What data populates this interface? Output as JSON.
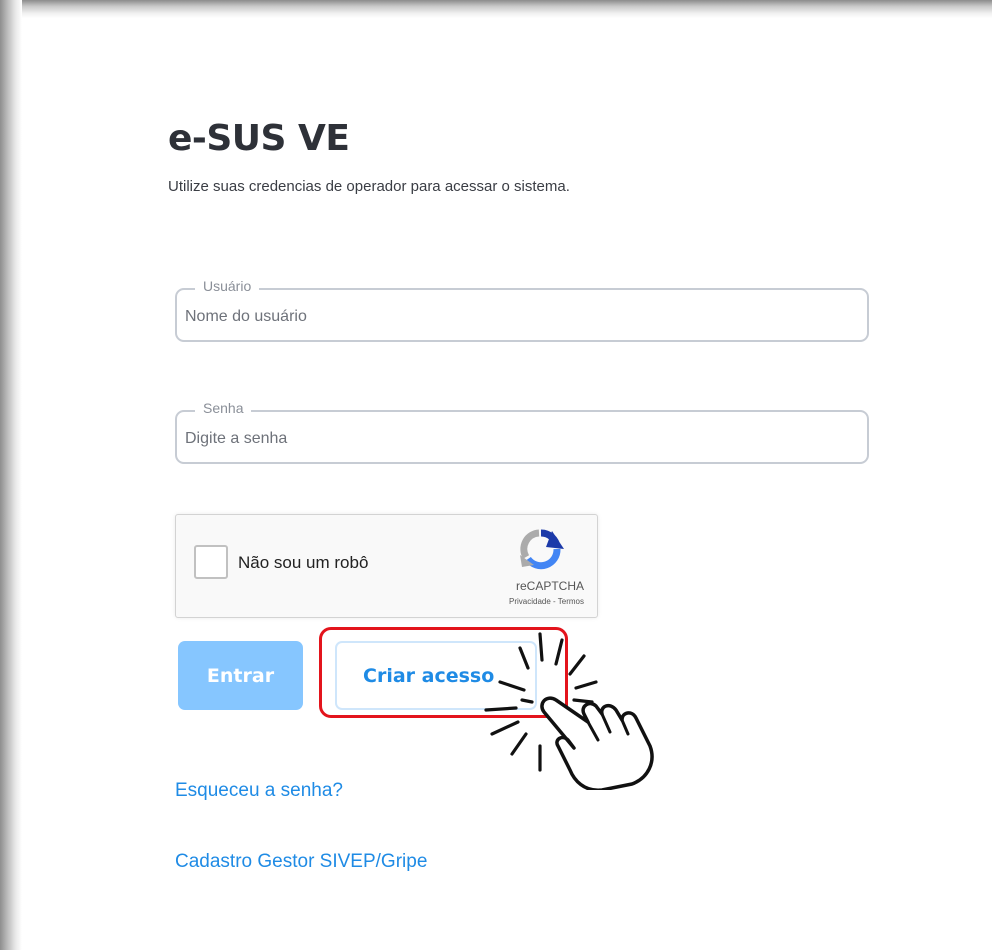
{
  "header": {
    "title": "e-SUS VE",
    "subtitle": "Utilize suas credencias de operador para acessar o sistema."
  },
  "form": {
    "username": {
      "legend": "Usuário",
      "placeholder": "Nome do usuário",
      "value": ""
    },
    "password": {
      "legend": "Senha",
      "placeholder": "Digite a senha",
      "value": ""
    },
    "captcha": {
      "label": "Não sou um robô",
      "brand": "reCAPTCHA",
      "links": "Privacidade - Termos",
      "checked": false
    },
    "buttons": {
      "login_label": "Entrar",
      "create_access_label": "Criar acesso"
    }
  },
  "links": {
    "forgot_password": "Esqueceu a senha?",
    "gestor_registration": "Cadastro Gestor SIVEP/Gripe"
  },
  "colors": {
    "primary": "#1f8be5",
    "primary_disabled": "#86c6ff",
    "highlight": "#e3141c",
    "text_dark": "#2e3138",
    "field_border": "#c7ccd4"
  },
  "icons": {
    "captcha_logo": "recaptcha-logo-icon",
    "pointer": "hand-pointer-icon"
  }
}
